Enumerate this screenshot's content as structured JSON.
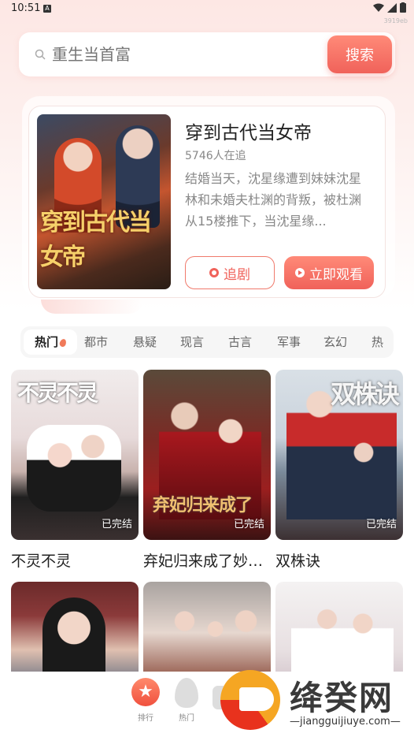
{
  "status_bar": {
    "time": "10:51",
    "notification": "A",
    "build_code": "3919eb"
  },
  "search": {
    "placeholder": "重生当首富",
    "button_label": "搜索"
  },
  "featured": {
    "title": "穿到古代当女帝",
    "followers": "5746人在追",
    "description": "结婚当天，沈星缘遭到妹妹沈星林和未婚夫杜渊的背叛，被杜渊从15楼推下，当沈星缘...",
    "follow_label": "追剧",
    "watch_label": "立即观看",
    "cover_art_text": "穿到古代当女帝"
  },
  "categories": [
    "热门",
    "都市",
    "悬疑",
    "现言",
    "古言",
    "军事",
    "玄幻",
    "热血"
  ],
  "active_category": "热门",
  "dramas": [
    {
      "name": "不灵不灵",
      "status": "已完结",
      "art": "不灵不灵"
    },
    {
      "name": "弃妃归来成了妙手神医",
      "status": "已完结",
      "art": "弃妃归来成了"
    },
    {
      "name": "双株诀",
      "status": "已完结",
      "art": "双株诀"
    },
    {
      "name": "",
      "status": "",
      "art": ""
    },
    {
      "name": "",
      "status": "",
      "art": ""
    },
    {
      "name": "",
      "status": "",
      "art": ""
    }
  ],
  "bottom_nav": [
    {
      "label": "排行",
      "icon": "star-badge-icon"
    },
    {
      "label": "热门",
      "icon": "flame-icon"
    }
  ],
  "watermark": {
    "name": "绛癸网",
    "url": "—jiangguijiuye.com—"
  },
  "colors": {
    "accent": "#f0625a",
    "accent_light": "#ff8a78",
    "text_primary": "#222222",
    "text_secondary": "#888888"
  }
}
